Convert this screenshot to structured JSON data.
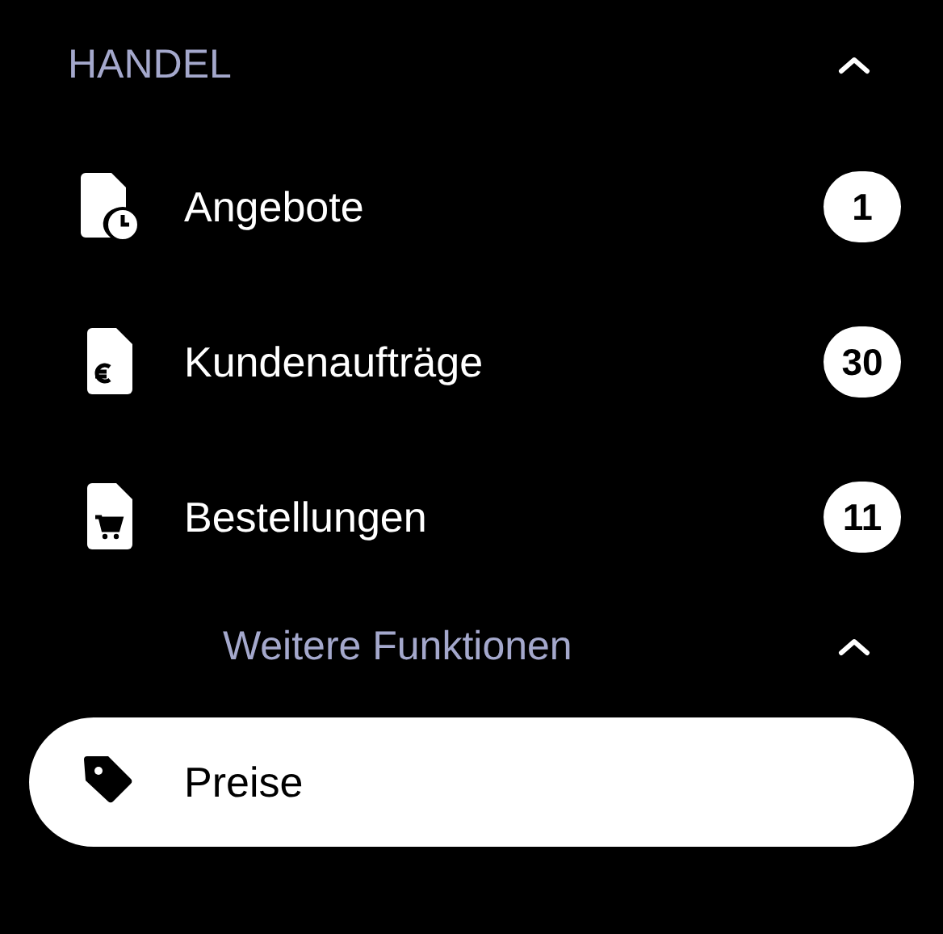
{
  "section": {
    "title": "HANDEL",
    "expanded": true
  },
  "items": [
    {
      "label": "Angebote",
      "badge": "1",
      "selected": false
    },
    {
      "label": "Kundenaufträge",
      "badge": "30",
      "selected": false
    },
    {
      "label": "Bestellungen",
      "badge": "11",
      "selected": false
    }
  ],
  "subsection": {
    "title": "Weitere Funktionen",
    "expanded": true,
    "items": [
      {
        "label": "Preise",
        "selected": true
      }
    ]
  }
}
